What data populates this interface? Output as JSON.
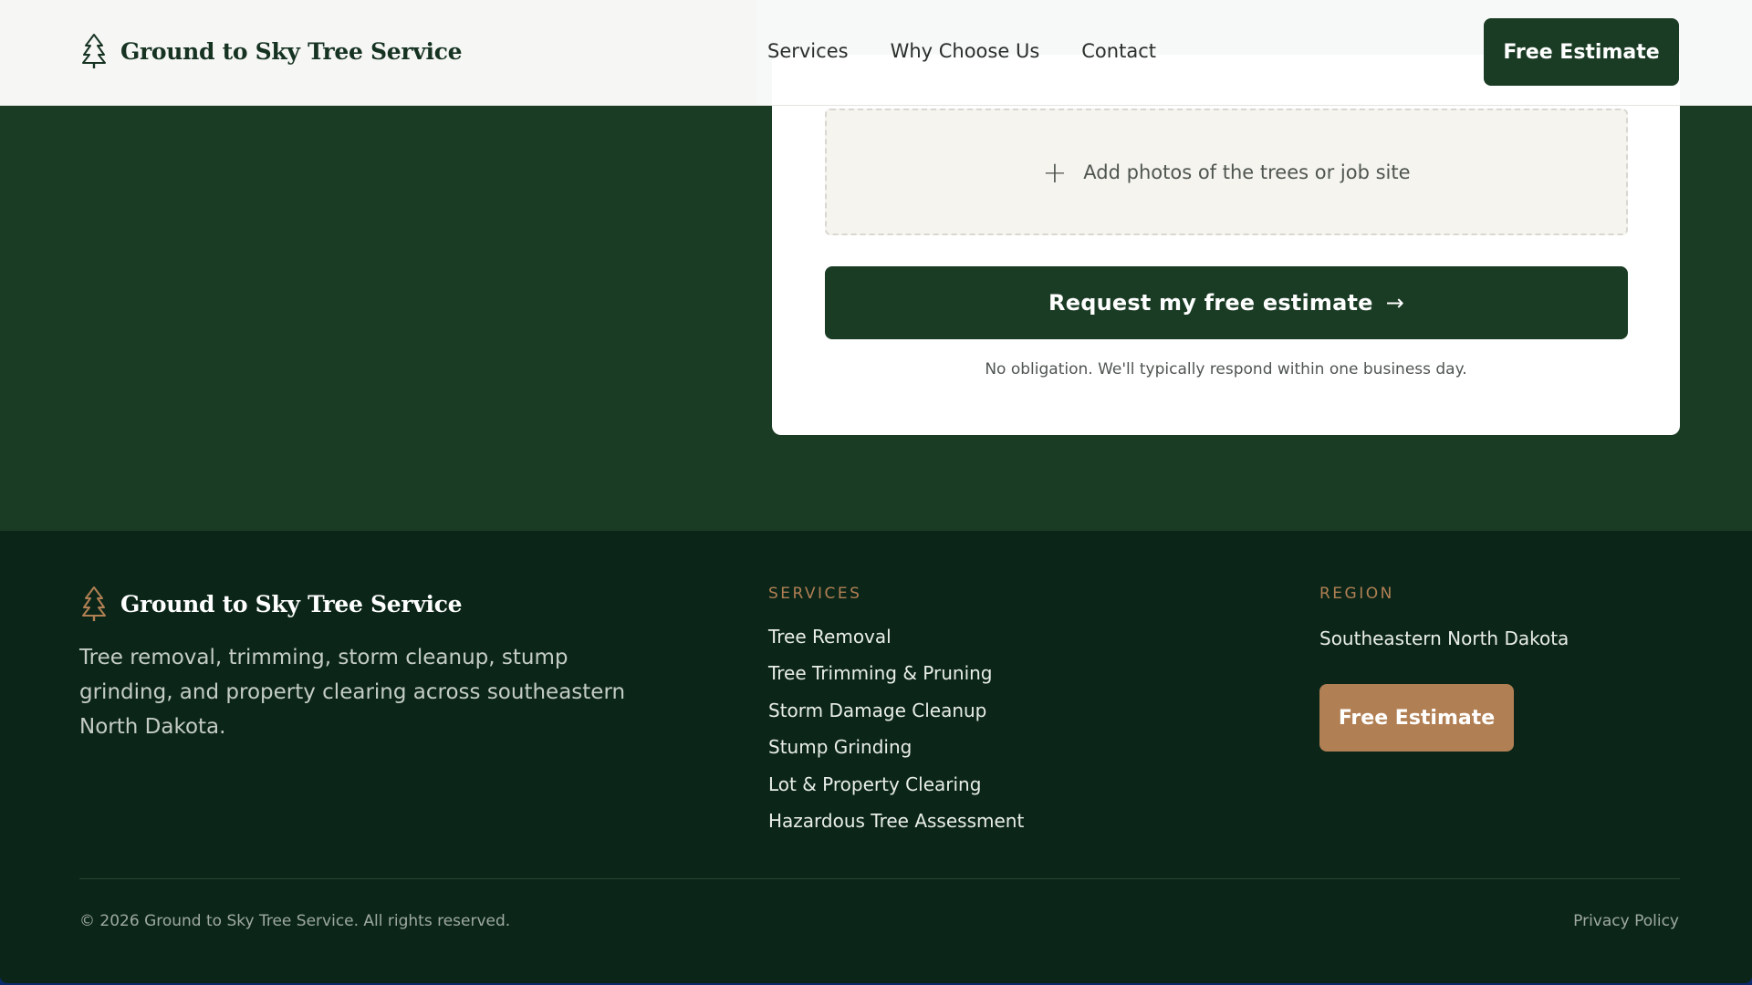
{
  "colors": {
    "primary_green": "#1a3b24",
    "footer_bg": "#0b2618",
    "accent_copper": "#b17f54",
    "nav_bg": "#ffffff"
  },
  "nav": {
    "brand_name": "Ground to Sky Tree Service",
    "brand_icon": "pine-tree-icon",
    "links": [
      "Services",
      "Why Choose Us",
      "Contact"
    ],
    "cta_label": "Free Estimate"
  },
  "form": {
    "upload_label": "Add photos of the trees or job site",
    "upload_icon": "plus-icon",
    "submit_label": "Request my free estimate",
    "submit_icon": "arrow-right-icon",
    "note": "No obligation. We'll typically respond within one business day."
  },
  "footer": {
    "brand_name": "Ground to Sky Tree Service",
    "description": "Tree removal, trimming, storm cleanup, stump grinding, and property clearing across southeastern North Dakota.",
    "services_heading": "SERVICES",
    "services": [
      "Tree Removal",
      "Tree Trimming & Pruning",
      "Storm Damage Cleanup",
      "Stump Grinding",
      "Lot & Property Clearing",
      "Hazardous Tree Assessment"
    ],
    "region_heading": "REGION",
    "region": "Southeastern North Dakota",
    "cta_label": "Free Estimate",
    "copyright": "© 2026 Ground to Sky Tree Service. All rights reserved.",
    "privacy_label": "Privacy Policy"
  }
}
